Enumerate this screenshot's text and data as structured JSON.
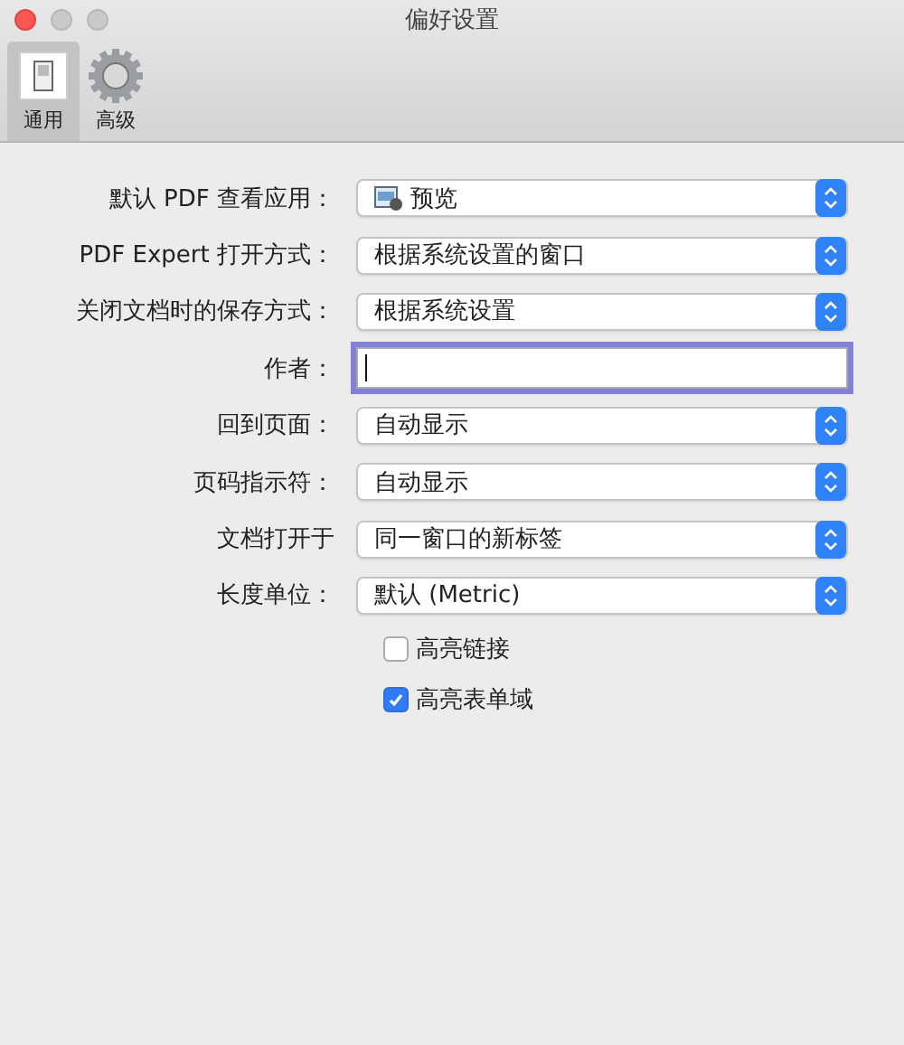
{
  "window": {
    "title": "偏好设置"
  },
  "tabs": [
    {
      "label": "通用",
      "selected": true
    },
    {
      "label": "高级",
      "selected": false
    }
  ],
  "rows": [
    {
      "kind": "popup",
      "label": "默认 PDF 查看应用：",
      "value": "预览"
    },
    {
      "kind": "popup",
      "label": "PDF Expert 打开方式：",
      "value": "根据系统设置的窗口"
    },
    {
      "kind": "popup",
      "label": "关闭文档时的保存方式：",
      "value": "根据系统设置"
    },
    {
      "kind": "text",
      "label": "作者：",
      "focused": true
    },
    {
      "kind": "popup",
      "label": "回到页面：",
      "value": "自动显示"
    },
    {
      "kind": "popup",
      "label": "页码指示符：",
      "value": "自动显示"
    },
    {
      "kind": "popup",
      "label": "文档打开于",
      "value": "同一窗口的新标签"
    },
    {
      "kind": "popup",
      "label": "长度单位：",
      "value": "默认 (Metric)"
    }
  ],
  "checkboxes": [
    {
      "label": "高亮链接",
      "checked": false
    },
    {
      "label": "高亮表单域",
      "checked": true
    }
  ]
}
